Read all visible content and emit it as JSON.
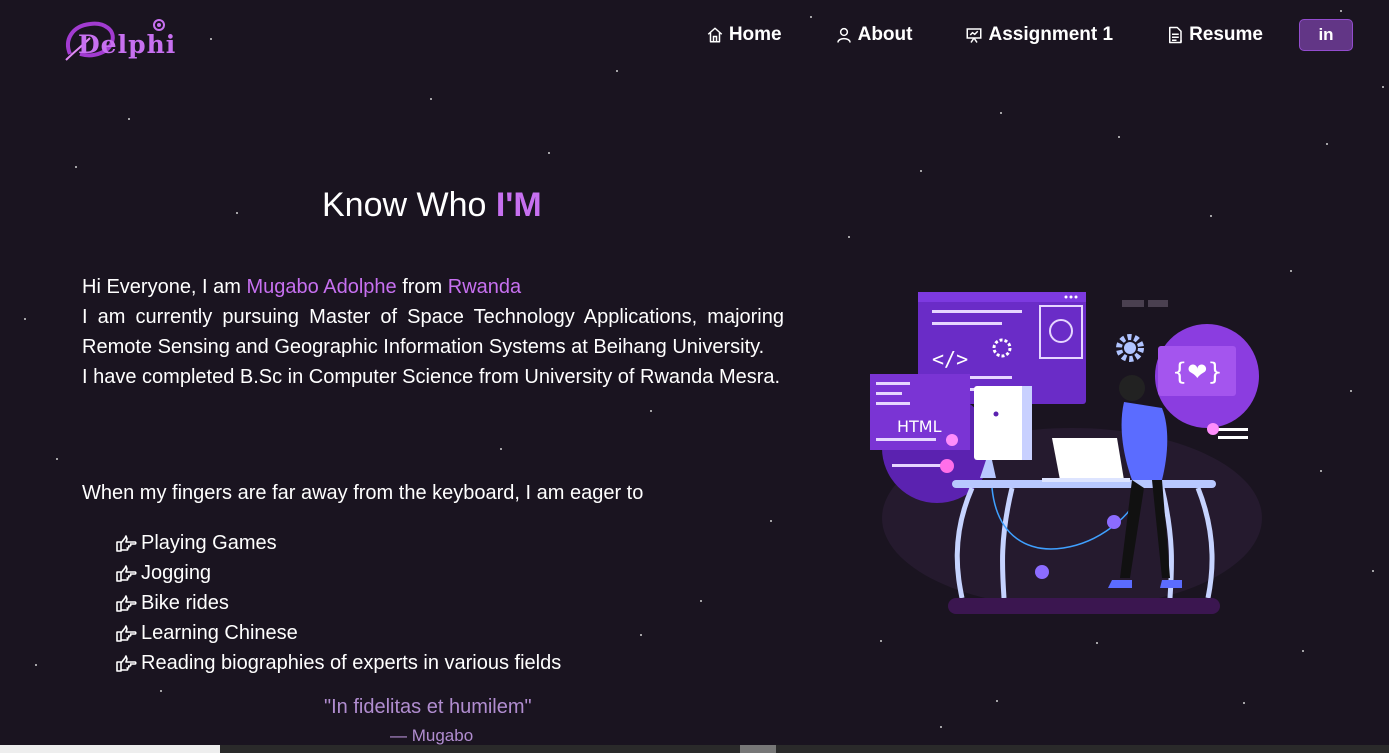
{
  "brand": {
    "logo_text": "Delphi"
  },
  "nav": {
    "items": [
      {
        "label": "Home",
        "icon": "home-icon"
      },
      {
        "label": "About",
        "icon": "user-icon"
      },
      {
        "label": "Assignment 1",
        "icon": "presentation-icon"
      },
      {
        "label": "Resume",
        "icon": "document-icon"
      }
    ],
    "linkedin_label": "in"
  },
  "about": {
    "title_prefix": "Know Who",
    "title_accent": "I'M",
    "intro_before": "Hi Everyone, I am",
    "name": "Mugabo Adolphe",
    "intro_mid": "from",
    "country": "Rwanda",
    "line2": "I am currently pursuing Master of Space Technology Applications, majoring Remote Sensing and Geographic Information Systems at Beihang University.",
    "line3": "I have completed B.Sc in Computer Science from University of Rwanda Mesra.",
    "eager": "When my fingers are far away from the keyboard, I am eager to",
    "hobbies": [
      "Playing Games",
      "Jogging",
      "Bike rides",
      "Learning Chinese",
      "Reading biographies of experts in various fields"
    ],
    "quote": "\"In fidelitas et humilem\"",
    "author": "— Mugabo"
  },
  "illustration": {
    "html_label": "HTML",
    "code_label": "</>",
    "heart_label": "{❤}"
  },
  "colors": {
    "background": "#1a1420",
    "accent": "#c770f0",
    "button": "#623686"
  }
}
